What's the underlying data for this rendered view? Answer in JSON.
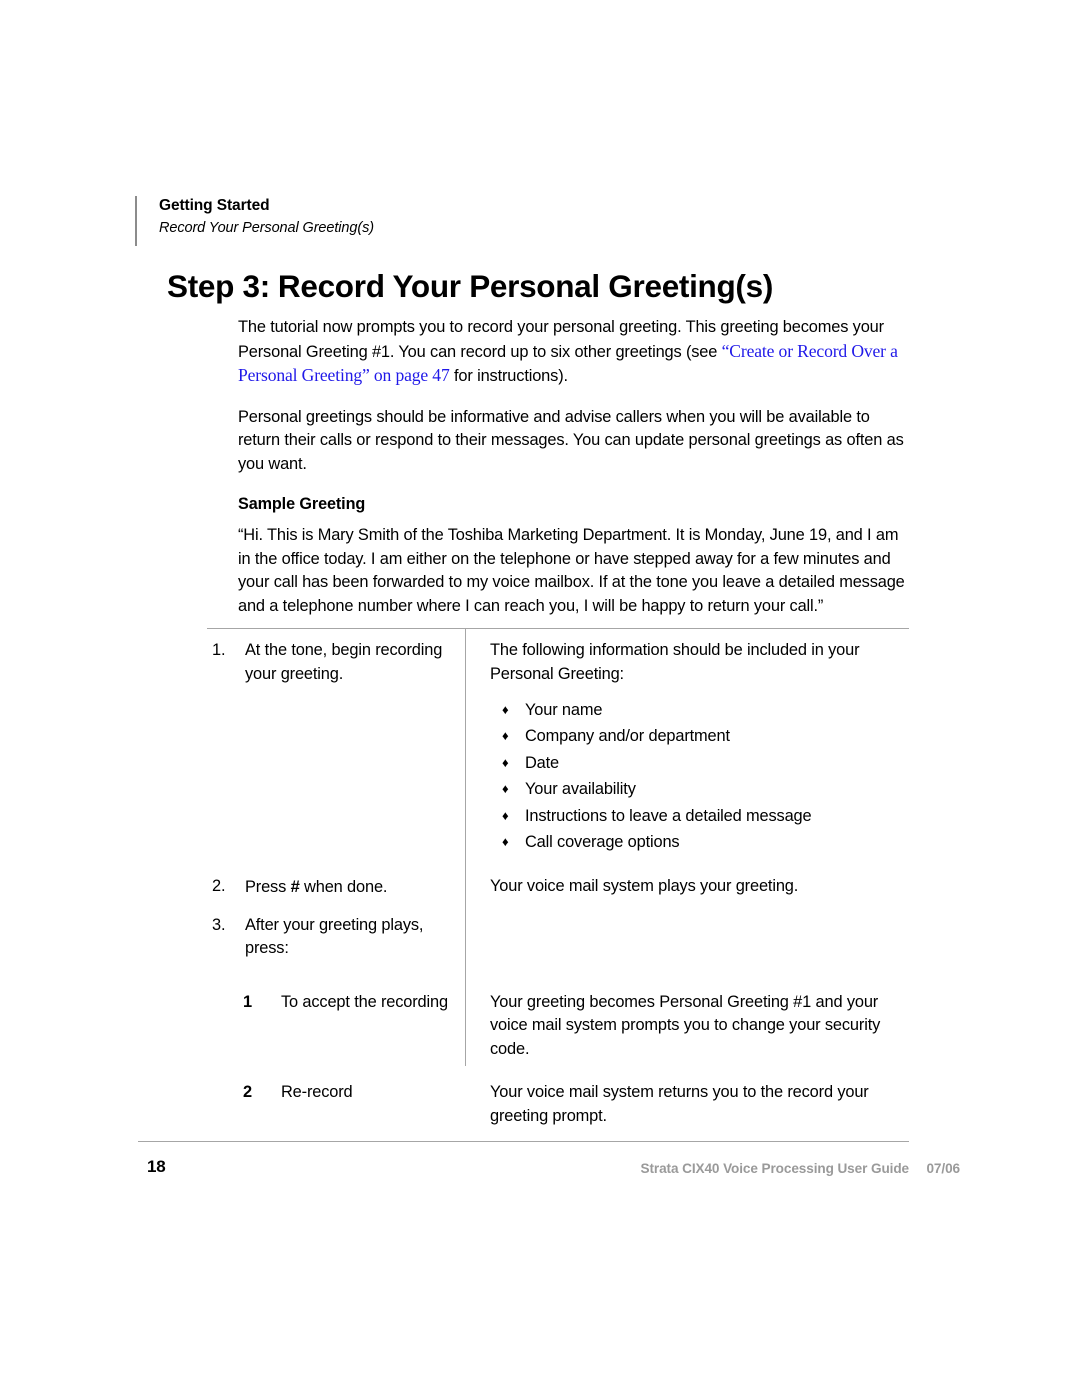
{
  "header": {
    "chapter": "Getting Started",
    "section": "Record Your Personal Greeting(s)"
  },
  "title": {
    "step_label": "Step 3:",
    "step_name": "Record Your Personal Greeting(s)"
  },
  "intro": {
    "para1_before_link": "The tutorial now prompts you to record your personal greeting. This greeting becomes your Personal Greeting #1. You can record up to six other greetings (see ",
    "para1_link": "“Create or Record Over a Personal Greeting” on page 47",
    "para1_after_link": " for instructions).",
    "para2": "Personal greetings should be informative and advise callers when you will be available to return their calls or respond to their messages. You can update personal greetings as often as you want."
  },
  "sample": {
    "heading": "Sample Greeting",
    "quote": "“Hi. This is Mary Smith of the Toshiba Marketing Department. It is Monday, June 19, and I am in the office today. I am either on the telephone or have stepped away for a few minutes and your call has been forwarded to my voice mailbox. If at the tone you leave a detailed message and a telephone number where I can reach you, I will be happy to return your call.”"
  },
  "procedure": {
    "step1": {
      "number": "1.",
      "action": "At the tone, begin recording your greeting.",
      "result_intro": "The following information should be included in your Personal Greeting:",
      "bullet_glyph": "♦",
      "bullets": [
        "Your name",
        "Company and/or department",
        "Date",
        "Your availability",
        "Instructions to leave a detailed message",
        "Call coverage options"
      ]
    },
    "step2": {
      "number": "2.",
      "action_before_key": "Press ",
      "key": "#",
      "action_after_key": " when done.",
      "result": "Your voice mail system plays your greeting."
    },
    "step3": {
      "number": "3.",
      "action": "After your greeting plays, press:",
      "options": [
        {
          "key": "1",
          "label": "To accept the recording",
          "result": "Your greeting becomes Personal Greeting #1 and your voice mail system prompts you to change your security code."
        },
        {
          "key": "2",
          "label": "Re-record",
          "result": "Your voice mail system returns you to the record your greeting prompt."
        }
      ]
    }
  },
  "footer": {
    "page_number": "18",
    "guide_title": "Strata CIX40 Voice Processing User Guide",
    "date": "07/06"
  },
  "colors": {
    "link": "#2019e8",
    "rule": "#a6a6a6",
    "footer_text": "#9a9a9a"
  }
}
